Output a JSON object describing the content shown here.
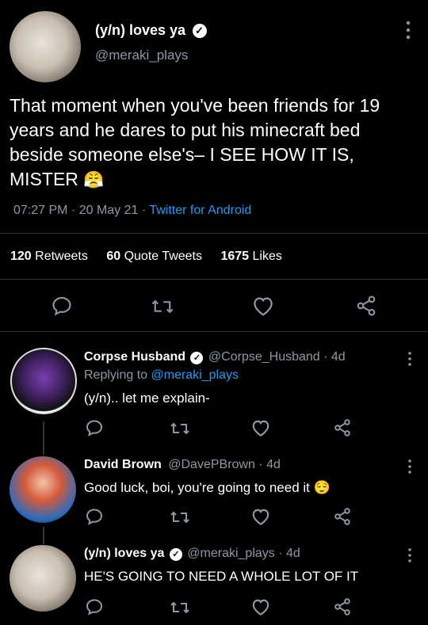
{
  "main_tweet": {
    "display_name": "(y/n) loves ya",
    "handle": "@meraki_plays",
    "text": "That moment when you've been friends for 19 years and he dares to put his minecraft bed beside someone else's– I SEE HOW IT IS, MISTER",
    "emoji": "😤",
    "time_date": "07:27 PM · 20 May 21 · ",
    "source": "Twitter for Android",
    "stats": {
      "retweets_count": "120",
      "retweets_label": "Retweets",
      "quotes_count": "60",
      "quotes_label": "Quote Tweets",
      "likes_count": "1675",
      "likes_label": "Likes"
    }
  },
  "replies": [
    {
      "display_name": "Corpse Husband",
      "handle_time": "@Corpse_Husband · 4d",
      "replying_prefix": "Replying to ",
      "replying_to": "@meraki_plays",
      "text": "(y/n).. let me explain-"
    },
    {
      "display_name": "David Brown",
      "handle_time": "@DavePBrown · 4d",
      "text": "Good luck, boi, you're going to need it",
      "emoji": "😌"
    },
    {
      "display_name": "(y/n) loves ya",
      "handle_time": "@meraki_plays · 4d",
      "text": "HE'S GOING TO NEED A WHOLE LOT OF IT"
    }
  ],
  "colors": {
    "background": "#000000",
    "text": "#e7e9ea",
    "muted": "#8b98a5",
    "link": "#1d9bf0",
    "divider": "#2f3336"
  },
  "icons": [
    "reply-icon",
    "retweet-icon",
    "like-icon",
    "share-icon",
    "more-icon",
    "verified-icon"
  ]
}
